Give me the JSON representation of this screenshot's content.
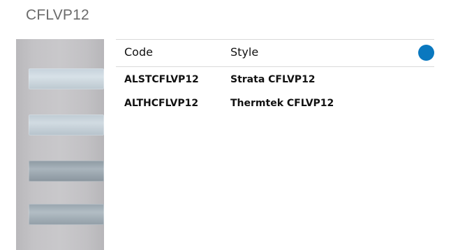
{
  "page": {
    "title": "CFLVP12"
  },
  "table": {
    "columns": {
      "code": "Code",
      "style": "Style"
    },
    "rows": [
      {
        "code": "ALSTCFLVP12",
        "style": "Strata CFLVP12"
      },
      {
        "code": "ALTHCFLVP12",
        "style": "Thermtek CFLVP12"
      }
    ]
  },
  "colors": {
    "accent_dot": "#0a78bf",
    "title_text": "#6b6b6b",
    "divider": "#d9d9d9"
  }
}
